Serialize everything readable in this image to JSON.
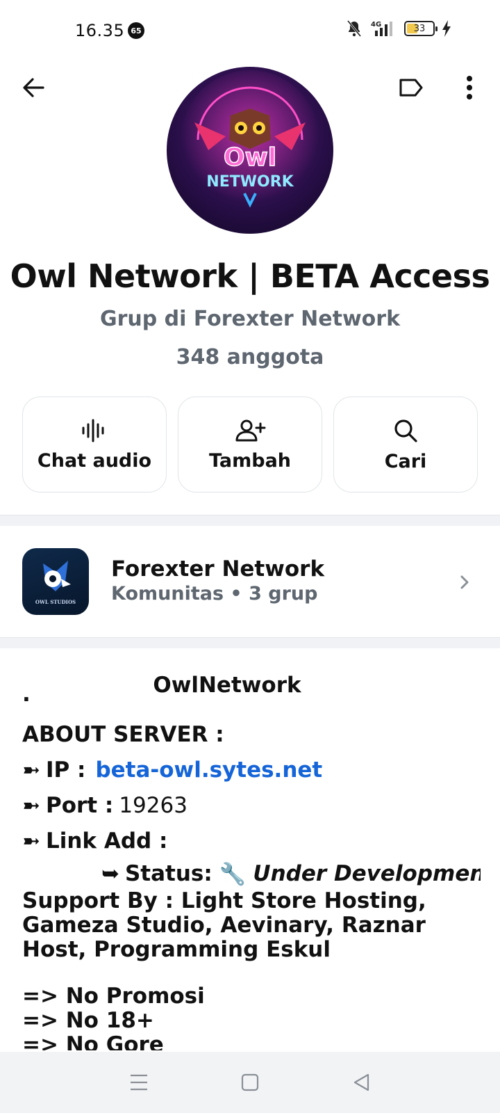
{
  "status_bar": {
    "time": "16.35",
    "notification_badge": "65",
    "network": "4G",
    "battery": "33"
  },
  "top_nav": {
    "back_icon": "arrow-left-icon",
    "label_icon": "label-tag-icon",
    "more_icon": "more-vertical-icon"
  },
  "group": {
    "title": "Owl Network | BETA Access",
    "subtitle": "Grup di Forexter Network",
    "member_count": "348 anggota",
    "avatar_text_top": "Owl",
    "avatar_text_bottom": "NETWORK"
  },
  "actions": [
    {
      "label": "Chat audio",
      "icon": "audio-waveform-icon"
    },
    {
      "label": "Tambah",
      "icon": "add-person-icon"
    },
    {
      "label": "Cari",
      "icon": "search-icon"
    }
  ],
  "community": {
    "name": "Forexter Network",
    "meta": "Komunitas • 3 grup",
    "logo_text": "OWL STUDIOS"
  },
  "description": {
    "dot": ".",
    "title": "OwlNetwork",
    "about": "ABOUT SERVER :",
    "arrow": "➼",
    "ip_label": "IP :",
    "ip_value": "beta-owl.sytes.net",
    "port_label": "Port :",
    "port_value": "19263",
    "link_label": "Link Add :",
    "status_arrow": "➥",
    "status_label": "Status:",
    "status_emoji": "🔧",
    "status_value": "Under Development!",
    "support": "Support By : Light Store Hosting, Gameza Studio, Aevinary, Raznar Host, Programming Eskul",
    "rules": [
      "=> No Promosi",
      "=> No 18+",
      "=> No Gore"
    ]
  },
  "colors": {
    "link": "#1565d8",
    "muted_text": "#5e6670",
    "divider": "#f0f2f5"
  }
}
